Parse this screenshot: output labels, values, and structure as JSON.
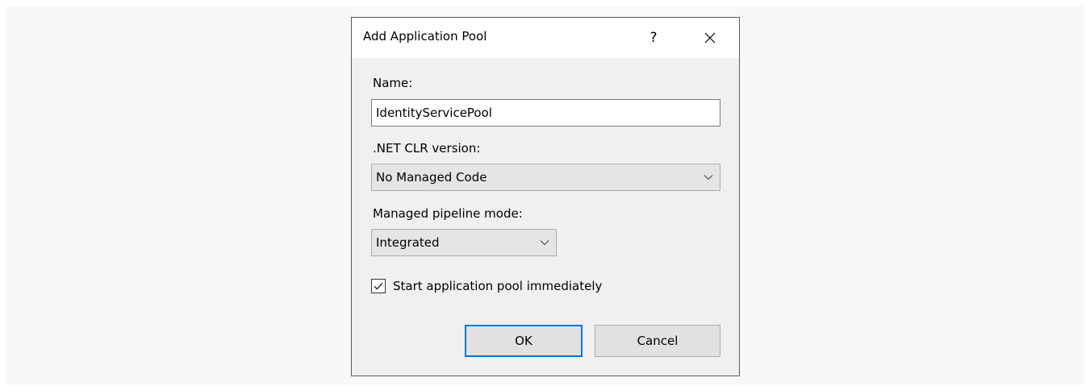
{
  "dialog": {
    "title": "Add Application Pool",
    "help_label": "?",
    "name": {
      "label": "Name:",
      "value": "IdentityServicePool"
    },
    "clr_version": {
      "label": ".NET CLR version:",
      "selected": "No Managed Code"
    },
    "pipeline_mode": {
      "label": "Managed pipeline mode:",
      "selected": "Integrated"
    },
    "start_immediately": {
      "label": "Start application pool immediately",
      "checked": true
    },
    "buttons": {
      "ok_label": "OK",
      "cancel_label": "Cancel"
    }
  },
  "icons": {
    "close": "close-icon",
    "dropdown": "chevron-down-icon",
    "checkmark": "checkmark-icon"
  },
  "colors": {
    "focus_accent": "#0078d7",
    "dialog_bg": "#f0f0f0",
    "titlebar_bg": "#ffffff",
    "backdrop_bg": "#f8f8f8"
  }
}
